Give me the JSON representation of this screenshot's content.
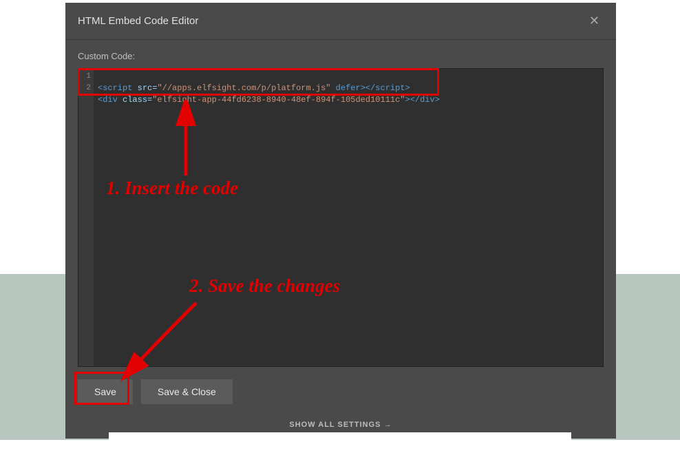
{
  "modal": {
    "title": "HTML Embed Code Editor",
    "section_label": "Custom Code:",
    "close_glyph": "✕"
  },
  "code": {
    "line_nums": [
      "1",
      "2"
    ],
    "line1": {
      "open": "<script",
      "attr1": " src=",
      "val1": "\"//apps.elfsight.com/p/platform.js\"",
      "attr2": " defer",
      "close": "></script>"
    },
    "line2": {
      "open": "<div",
      "attr1": " class=",
      "val1": "\"elfsight-app-44fd6238-8940-48ef-894f-105ded10111c\"",
      "close": "></div>"
    }
  },
  "buttons": {
    "save": "Save",
    "save_close": "Save & Close"
  },
  "footer": {
    "show_all": "SHOW ALL SETTINGS  →"
  },
  "annotations": {
    "step1": "1. Insert the code",
    "step2": "2. Save the changes"
  }
}
